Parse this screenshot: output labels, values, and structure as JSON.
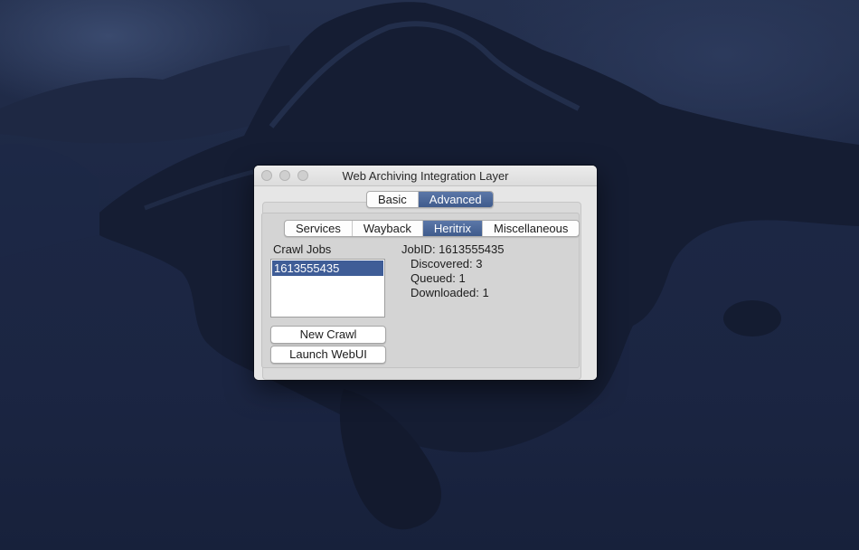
{
  "window": {
    "title": "Web Archiving Integration Layer"
  },
  "top_tabs": [
    {
      "label": "Basic",
      "selected": false
    },
    {
      "label": "Advanced",
      "selected": true
    }
  ],
  "sub_tabs": [
    {
      "label": "Services",
      "selected": false
    },
    {
      "label": "Wayback",
      "selected": false
    },
    {
      "label": "Heritrix",
      "selected": true
    },
    {
      "label": "Miscellaneous",
      "selected": false
    }
  ],
  "heritrix": {
    "crawl_jobs_label": "Crawl Jobs",
    "jobs": [
      "1613555435"
    ],
    "selected_job": "1613555435",
    "new_crawl_label": "New Crawl",
    "launch_webui_label": "Launch WebUI",
    "job_id_text": "JobID: 1613555435",
    "discovered_text": "Discovered: 3",
    "queued_text": "Queued: 1",
    "downloaded_text": "Downloaded: 1"
  },
  "colors": {
    "selection": "#3f5d97",
    "segment_selected": "#4a669a",
    "window_bg": "#e6e6e6"
  }
}
